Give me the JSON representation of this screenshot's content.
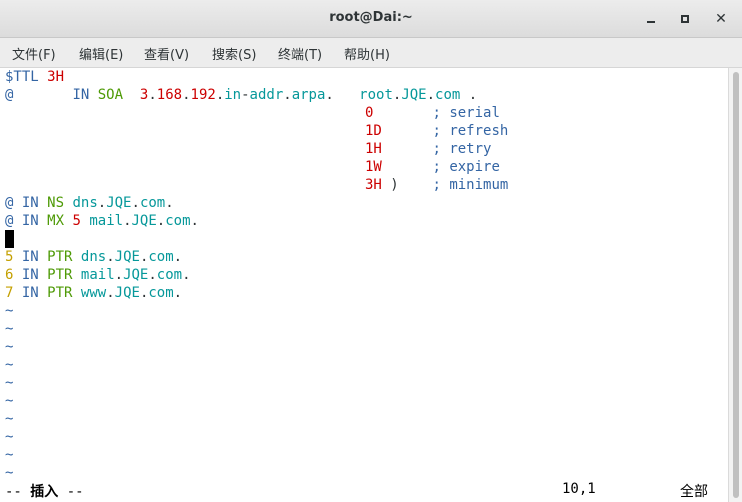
{
  "window": {
    "title": "root@Dai:~",
    "min_glyph": "",
    "close_glyph": "✕"
  },
  "menu": [
    "文件(F)",
    "编辑(E)",
    "查看(V)",
    "搜索(S)",
    "终端(T)",
    "帮助(H)"
  ],
  "file": {
    "ttl": [
      "$TTL",
      "3H"
    ],
    "soa": [
      "@",
      "IN",
      "SOA",
      "3",
      ".",
      "168",
      ".",
      "192",
      ".",
      "in",
      "-",
      "addr",
      ".",
      "arpa",
      ".",
      "root",
      ".",
      "JQE",
      ".",
      "com",
      ".",
      "("
    ],
    "serial": [
      "0",
      ";",
      "serial"
    ],
    "refresh": [
      "1D",
      ";",
      "refresh"
    ],
    "retry": [
      "1H",
      ";",
      "retry"
    ],
    "expire": [
      "1W",
      ";",
      "expire"
    ],
    "minimum": [
      "3H",
      ")",
      ";",
      "minimum"
    ],
    "ns": [
      "@",
      "IN",
      "NS",
      "dns",
      ".",
      "JQE",
      ".",
      "com",
      "."
    ],
    "mx": [
      "@",
      "IN",
      "MX",
      "5",
      "mail",
      ".",
      "JQE",
      ".",
      "com",
      "."
    ],
    "ptr1": [
      "5",
      "IN",
      "PTR",
      "dns",
      ".",
      "JQE",
      ".",
      "com",
      "."
    ],
    "ptr2": [
      "6",
      "IN",
      "PTR",
      "mail",
      ".",
      "JQE",
      ".",
      "com",
      "."
    ],
    "ptr3": [
      "7",
      "IN",
      "PTR",
      "www",
      ".",
      "JQE",
      ".",
      "com",
      "."
    ],
    "tilde": "~"
  },
  "status": {
    "mode_prefix": "--",
    "mode": "插入",
    "mode_suffix": "--",
    "position": "10,1",
    "scope": "全部"
  }
}
